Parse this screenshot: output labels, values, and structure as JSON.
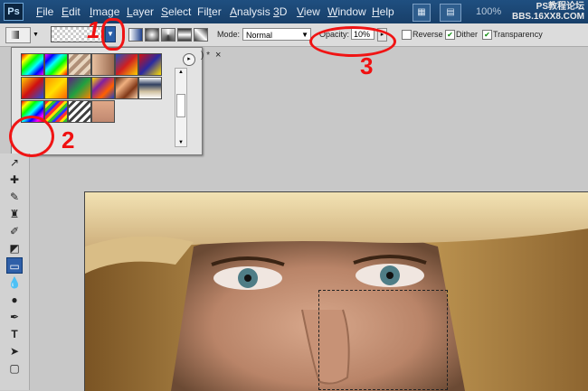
{
  "app": {
    "logo": "Ps"
  },
  "menu": {
    "items": [
      {
        "pre": "",
        "u": "F",
        "post": "ile"
      },
      {
        "pre": "",
        "u": "E",
        "post": "dit"
      },
      {
        "pre": "",
        "u": "I",
        "post": "mage"
      },
      {
        "pre": "",
        "u": "L",
        "post": "ayer"
      },
      {
        "pre": "",
        "u": "S",
        "post": "elect"
      },
      {
        "pre": "Fil",
        "u": "t",
        "post": "er"
      },
      {
        "pre": "",
        "u": "A",
        "post": "nalysis"
      },
      {
        "pre": "",
        "u": "3",
        "post": "D"
      },
      {
        "pre": "",
        "u": "V",
        "post": "iew"
      },
      {
        "pre": "",
        "u": "W",
        "post": "indow"
      },
      {
        "pre": "",
        "u": "H",
        "post": "elp"
      }
    ],
    "zoom": "100%",
    "watermark_line1": "PS教程论坛",
    "watermark_line2": "BBS.16XX8.COM"
  },
  "options": {
    "mode_label": "Mode:",
    "mode_value": "Normal",
    "opacity_label": "Opacity:",
    "opacity_value": "10%",
    "reverse_label": "Reverse",
    "dither_label": "Dither",
    "transparency_label": "Transparency",
    "reverse_checked": false,
    "dither_checked": true,
    "transparency_checked": true
  },
  "doc_tab": {
    "label": ") * ",
    "close": "×"
  },
  "picker": {
    "menu_glyph": "▸",
    "swatches": [
      "foreground-to-background",
      "foreground-to-transparent",
      "black-white",
      "red-green",
      "violet-orange",
      "blue-red-yellow",
      "blue-yellow-blue",
      "orange-yellow-orange",
      "violet-green-orange",
      "yellow-violet-orange-blue",
      "copper",
      "chrome",
      "spectrum",
      "transparent-rainbow",
      "transparent-stripes",
      "skin-tone"
    ]
  },
  "annotations": {
    "one": "1",
    "two": "2",
    "three": "3"
  },
  "colors": {
    "menubar": "#1f4f80",
    "annotation": "#f01010",
    "accent": "#2a5ea8"
  }
}
